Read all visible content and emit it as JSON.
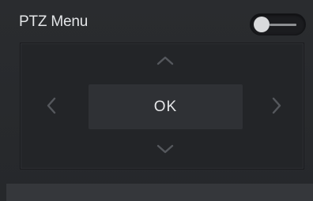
{
  "panel": {
    "title": "PTZ Menu",
    "toggle": {
      "state": "off"
    }
  },
  "dpad": {
    "ok_label": "OK",
    "up_icon": "chevron-up-icon",
    "down_icon": "chevron-down-icon",
    "left_icon": "chevron-left-icon",
    "right_icon": "chevron-right-icon"
  },
  "colors": {
    "background": "#2a2c2f",
    "pad_background": "#232528",
    "button_background": "#2f3135",
    "text": "#e4e6e8",
    "arrow": "#55585d"
  }
}
